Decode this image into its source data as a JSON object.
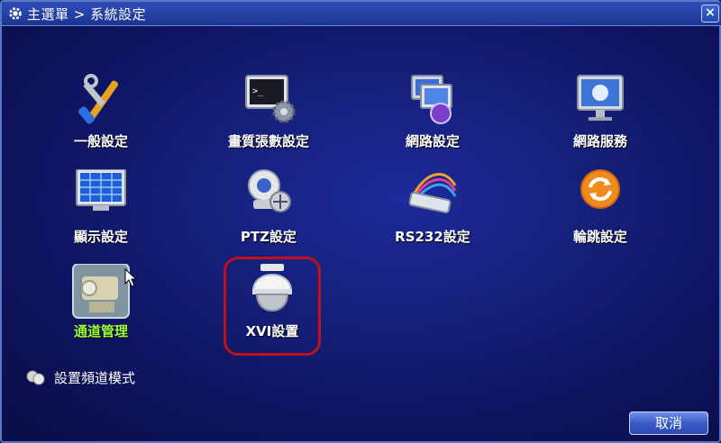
{
  "window": {
    "title": "主選單 > 系統設定",
    "close_label": "×"
  },
  "tiles": [
    {
      "label": "一般設定",
      "icon": "tools-icon"
    },
    {
      "label": "畫質張數設定",
      "icon": "terminal-gear-icon"
    },
    {
      "label": "網路設定",
      "icon": "network-icon"
    },
    {
      "label": "網路服務",
      "icon": "monitor-globe-icon"
    },
    {
      "label": "顯示設定",
      "icon": "display-grid-icon"
    },
    {
      "label": "PTZ設定",
      "icon": "ptz-camera-icon"
    },
    {
      "label": "RS232設定",
      "icon": "serial-cable-icon"
    },
    {
      "label": "輪跳設定",
      "icon": "refresh-icon"
    },
    {
      "label": "通道管理",
      "icon": "channel-camera-icon",
      "selected": true
    },
    {
      "label": "XVI設置",
      "icon": "dome-camera-icon"
    }
  ],
  "mode": {
    "label": "設置頻道模式",
    "icon": "cameras-icon"
  },
  "cancel_label": "取消",
  "colors": {
    "background": "#15207a",
    "selected_label": "#9cff3a",
    "highlight_border": "#c0101a"
  }
}
